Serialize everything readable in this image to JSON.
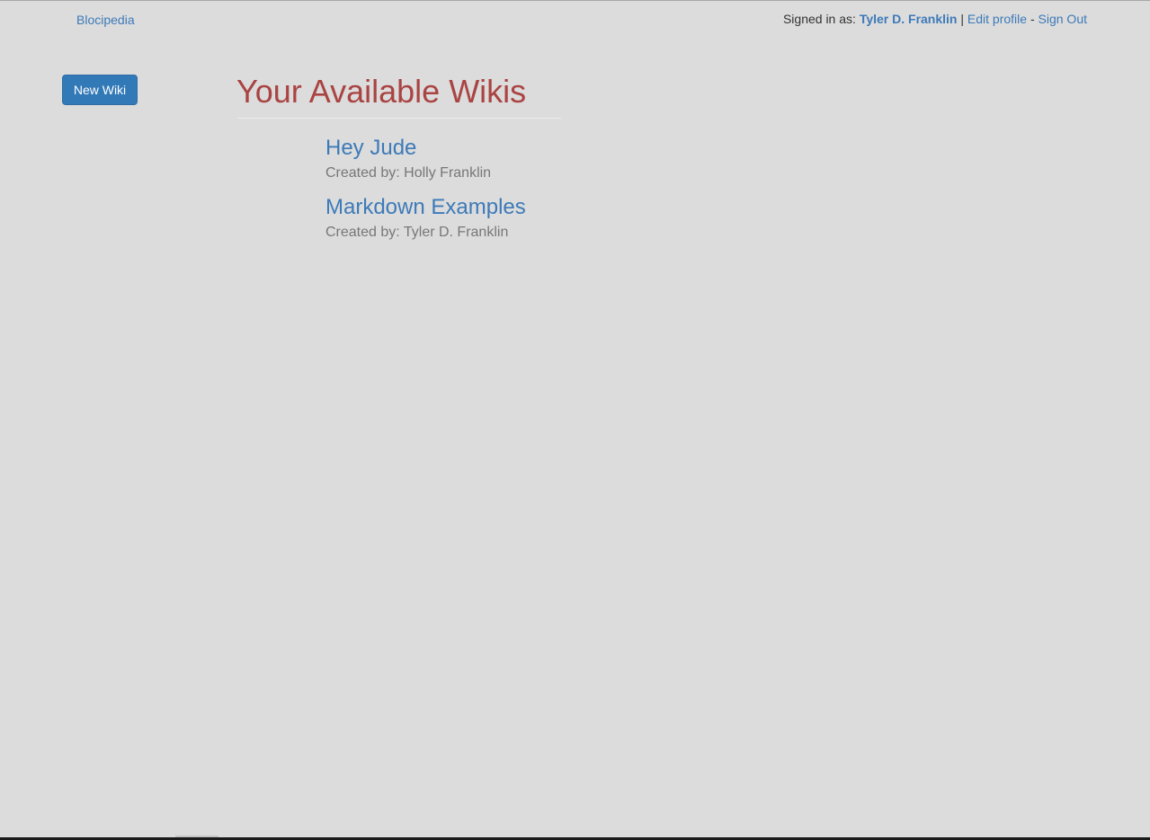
{
  "nav": {
    "brand": "Blocipedia",
    "signed_in_prefix": "Signed in as:",
    "user_name": "Tyler D. Franklin",
    "separator_pipe": "|",
    "edit_profile": "Edit profile",
    "separator_dash": "-",
    "sign_out": "Sign Out"
  },
  "sidebar": {
    "new_wiki_label": "New Wiki"
  },
  "main": {
    "title": "Your Available Wikis",
    "wikis": [
      {
        "title": "Hey Jude",
        "meta": "Created by: Holly Franklin"
      },
      {
        "title": "Markdown Examples",
        "meta": "Created by: Tyler D. Franklin"
      }
    ]
  },
  "colors": {
    "background": "#dcdcdc",
    "link": "#3d7ab8",
    "title": "#a94442",
    "button": "#3279b7",
    "muted": "#777777"
  }
}
